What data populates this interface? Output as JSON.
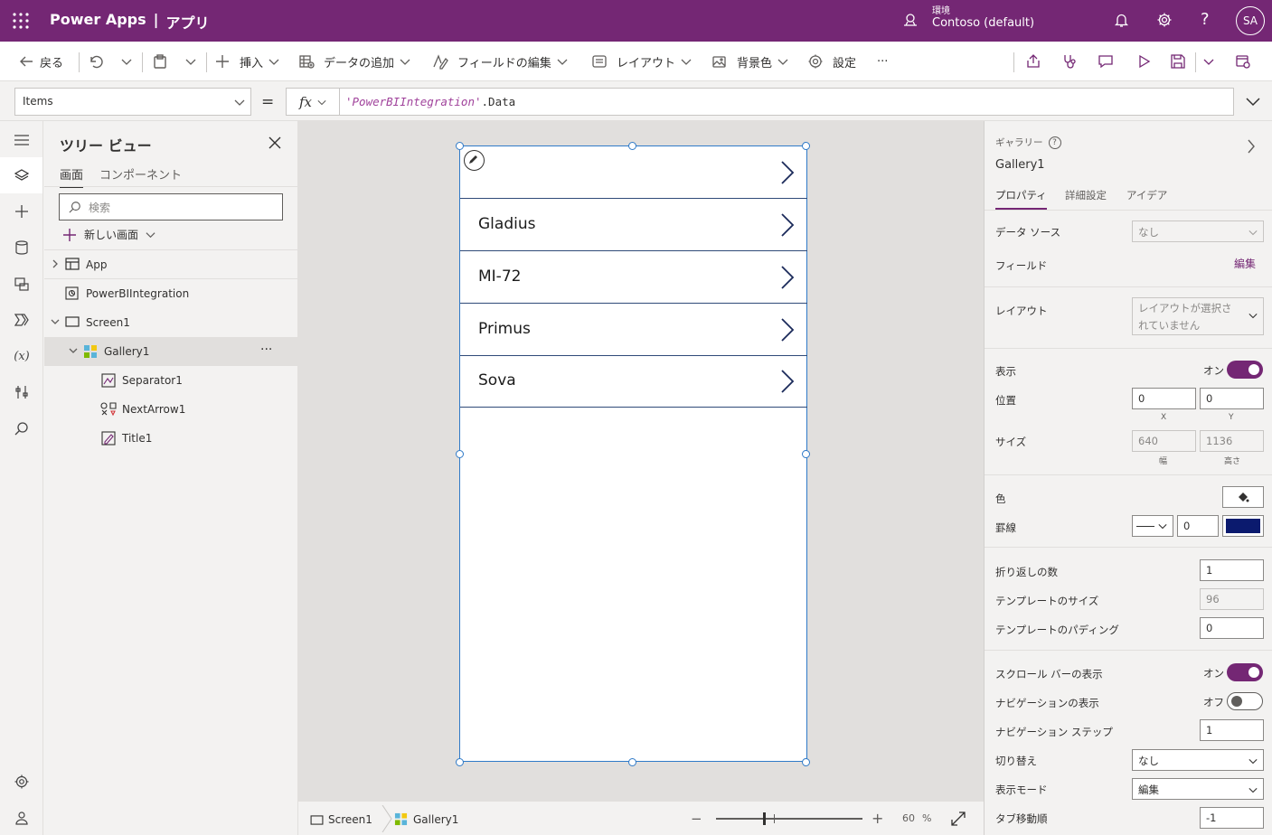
{
  "header": {
    "app_name": "Power Apps",
    "divider": "|",
    "app_title": "アプリ",
    "env_label": "環境",
    "env_name": "Contoso (default)",
    "user_initials": "SA"
  },
  "toolbar": {
    "back": "戻る",
    "insert": "挿入",
    "add_data": "データの追加",
    "edit_fields": "フィールドの編集",
    "layout": "レイアウト",
    "background": "背景色",
    "settings": "設定",
    "more": "···"
  },
  "formula_bar": {
    "property": "Items",
    "equals": "=",
    "fx": "fx",
    "formula_string": "'PowerBIIntegration'",
    "formula_rest": ".Data"
  },
  "tree_view": {
    "title": "ツリー ビュー",
    "tab_screens": "画面",
    "tab_components": "コンポーネント",
    "search_placeholder": "検索",
    "new_screen": "新しい画面",
    "more": "···",
    "items": [
      {
        "label": "App"
      },
      {
        "label": "PowerBIIntegration"
      },
      {
        "label": "Screen1"
      },
      {
        "label": "Gallery1"
      },
      {
        "label": "Separator1"
      },
      {
        "label": "NextArrow1"
      },
      {
        "label": "Title1"
      }
    ]
  },
  "gallery": {
    "items": [
      "",
      "Gladius",
      "MI-72",
      "Primus",
      "Sova"
    ]
  },
  "status_bar": {
    "screen": "Screen1",
    "gallery": "Gallery1",
    "zoom": "60",
    "zoom_unit": "%",
    "zoom_level": 0.32
  },
  "properties": {
    "type_label": "ギャラリー",
    "control_name": "Gallery1",
    "tabs": [
      "プロパティ",
      "詳細設定",
      "アイデア"
    ],
    "data_source_label": "データ ソース",
    "data_source_value": "なし",
    "fields_label": "フィールド",
    "fields_edit": "編集",
    "layout_label": "レイアウト",
    "layout_value": "レイアウトが選択されていません",
    "visible_label": "表示",
    "visible_state": "オン",
    "position_label": "位置",
    "x_value": "0",
    "y_value": "0",
    "x_caption": "X",
    "y_caption": "Y",
    "size_label": "サイズ",
    "width_value": "640",
    "height_value": "1136",
    "width_caption": "幅",
    "height_caption": "高さ",
    "color_label": "色",
    "border_label": "罫線",
    "border_width": "0",
    "border_color": "#0b1a6e",
    "wrap_label": "折り返しの数",
    "wrap_value": "1",
    "template_size_label": "テンプレートのサイズ",
    "template_size_value": "96",
    "template_padding_label": "テンプレートのパディング",
    "template_padding_value": "0",
    "scrollbar_label": "スクロール バーの表示",
    "scrollbar_state": "オン",
    "navigation_label": "ナビゲーションの表示",
    "navigation_state": "オフ",
    "nav_step_label": "ナビゲーション ステップ",
    "nav_step_value": "1",
    "transition_label": "切り替え",
    "transition_value": "なし",
    "display_mode_label": "表示モード",
    "display_mode_value": "編集",
    "tab_index_label": "タブ移動順",
    "tab_index_value": "-1"
  },
  "colors": {
    "brand": "#742774",
    "selection": "#2f7ac8"
  }
}
